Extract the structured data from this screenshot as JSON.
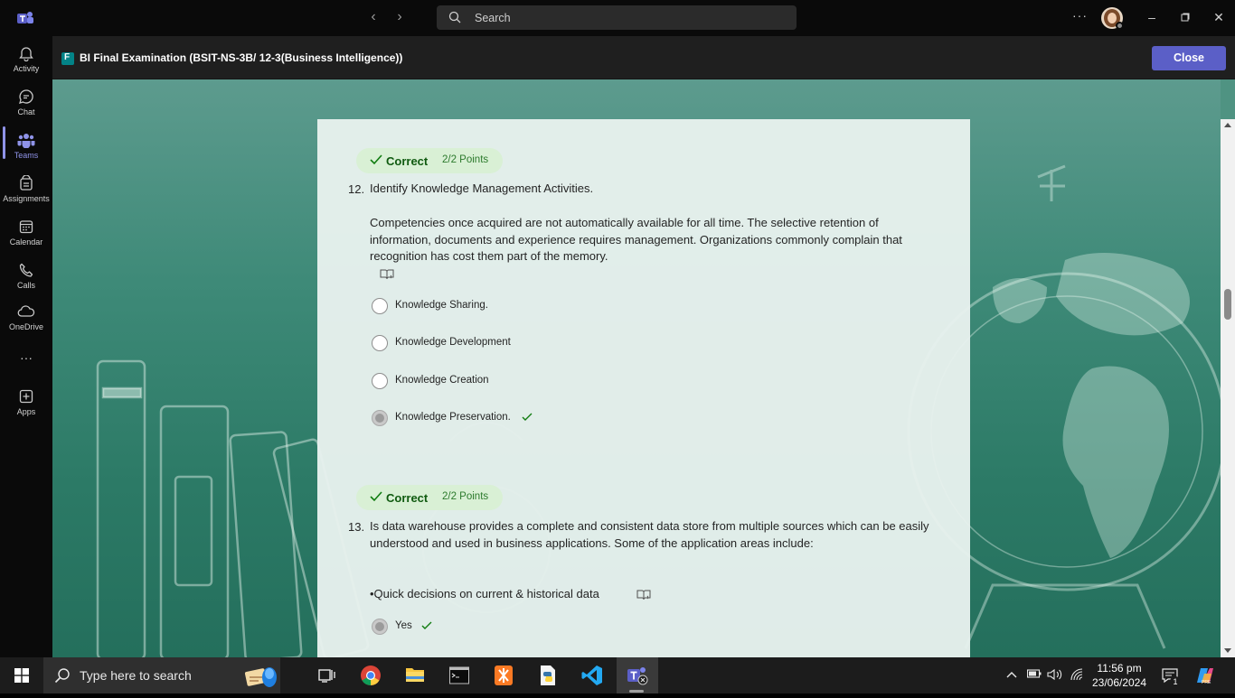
{
  "titlebar": {
    "search_placeholder": "Search",
    "more_label": "···"
  },
  "rail": {
    "items": [
      {
        "label": "Activity",
        "icon": "bell-icon"
      },
      {
        "label": "Chat",
        "icon": "chat-icon"
      },
      {
        "label": "Teams",
        "icon": "teams-icon",
        "active": true
      },
      {
        "label": "Assignments",
        "icon": "assignments-icon"
      },
      {
        "label": "Calendar",
        "icon": "calendar-icon"
      },
      {
        "label": "Calls",
        "icon": "phone-icon"
      },
      {
        "label": "OneDrive",
        "icon": "cloud-icon"
      },
      {
        "label": "",
        "icon": "more-icon"
      },
      {
        "label": "Apps",
        "icon": "plus-icon"
      }
    ],
    "more_glyph": "···"
  },
  "header": {
    "title": "BI Final Examination (BSIT-NS-3B/ 12-3(Business Intelligence))",
    "close_label": "Close"
  },
  "questions": [
    {
      "badge": "Correct",
      "points": "2/2 Points",
      "number": "12.",
      "title": "Identify Knowledge Management Activities.",
      "body": "Competencies once acquired are not automatically available for all time. The selective retention of information, documents and experience requires management. Organizations commonly complain that recognition has cost them part of the memory.",
      "options": [
        {
          "label": "Knowledge Sharing.",
          "selected": false,
          "correct": false
        },
        {
          "label": "Knowledge Development",
          "selected": false,
          "correct": false
        },
        {
          "label": "Knowledge Creation",
          "selected": false,
          "correct": false
        },
        {
          "label": "Knowledge Preservation.",
          "selected": true,
          "correct": true
        }
      ]
    },
    {
      "badge": "Correct",
      "points": "2/2 Points",
      "number": "13.",
      "title": "Is data warehouse provides a complete and consistent data store from multiple sources which can be easily understood and used in business applications. Some of the application areas include:",
      "sub": "•Quick decisions on current & historical data",
      "options": [
        {
          "label": "Yes",
          "selected": true,
          "correct": true
        }
      ]
    }
  ],
  "taskbar": {
    "search_label": "Type here to search",
    "time": "11:56 pm",
    "date": "23/06/2024",
    "notifications": "1"
  },
  "colors": {
    "accent": "#5b5fc7",
    "correct_bg": "#d9f0d5",
    "correct_text": "#0f5a0f",
    "background_green": "#3e8a78"
  }
}
